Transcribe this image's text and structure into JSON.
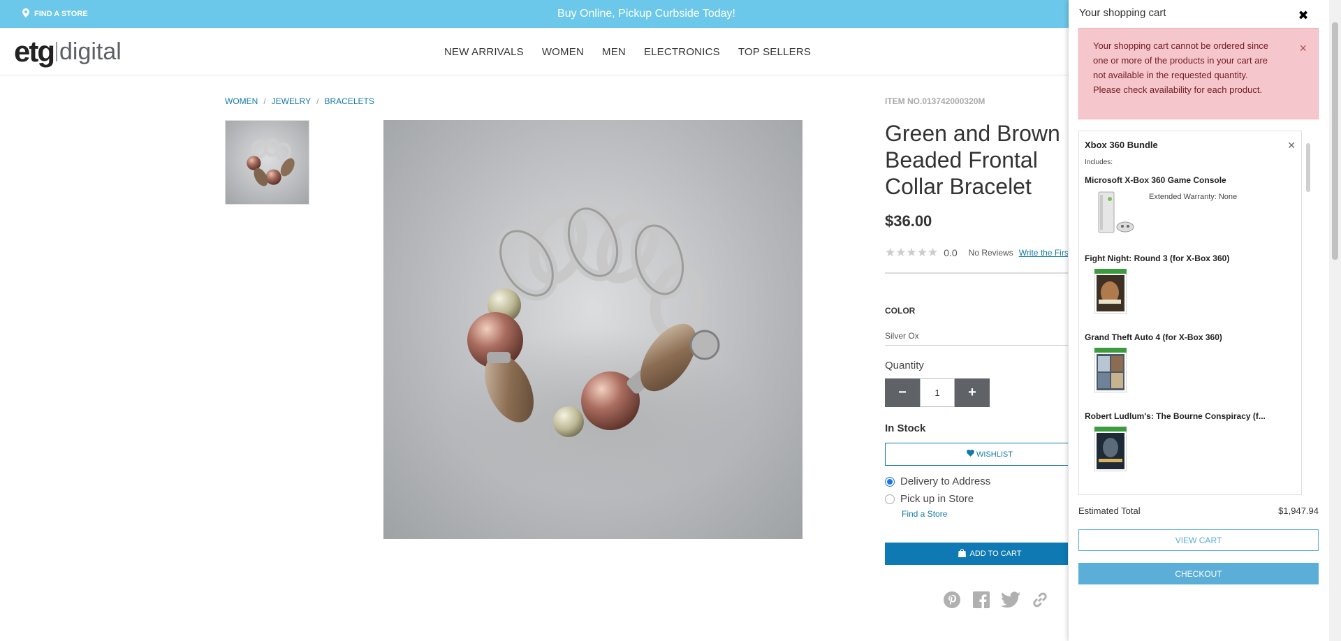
{
  "promo": {
    "find_store": "FIND A STORE",
    "message": "Buy Online, Pickup Curbside Today!"
  },
  "logo": {
    "part1": "etg",
    "part2": "digital"
  },
  "nav": [
    "NEW ARRIVALS",
    "WOMEN",
    "MEN",
    "ELECTRONICS",
    "TOP SELLERS"
  ],
  "breadcrumb": [
    "WOMEN",
    "JEWELRY",
    "BRACELETS"
  ],
  "product": {
    "item_no": "ITEM NO.013742000320M",
    "title": "Green and Brown Beaded Frontal Collar Bracelet",
    "price": "$36.00",
    "rating": "0.0",
    "reviews": "No Reviews",
    "write_review": "Write the First Review",
    "color_label": "COLOR",
    "color_value": "Silver Ox",
    "quantity_label": "Quantity",
    "quantity": "1",
    "stock": "In Stock",
    "wishlist": "WISHLIST",
    "delivery_options": [
      "Delivery to Address",
      "Pick up in Store"
    ],
    "find_store": "Find a Store",
    "add_to_cart": "ADD TO CART"
  },
  "cart": {
    "title": "Your shopping cart",
    "alert": "Your shopping cart cannot be ordered since one or more of the products in your cart are not available in the requested quantity. Please check availability for each product.",
    "bundle_name": "Xbox 360 Bundle",
    "includes_label": "Includes:",
    "items": [
      {
        "name": "Microsoft X-Box 360 Game Console",
        "warranty": "Extended Warranty: None"
      },
      {
        "name": "Fight Night: Round 3 (for X-Box 360)"
      },
      {
        "name": "Grand Theft Auto 4 (for X-Box 360)"
      },
      {
        "name": "Robert Ludlum's: The Bourne Conspiracy (f..."
      }
    ],
    "estimated_label": "Estimated Total",
    "estimated_total": "$1,947.94",
    "view_cart": "VIEW CART",
    "checkout": "CHECKOUT"
  },
  "colors": {
    "promo_bar": "#6cc8ea",
    "link": "#1479a8",
    "add_to_cart": "#0f79b3",
    "alert_bg": "#f5c6cb",
    "cart_button": "#5aaed8"
  }
}
